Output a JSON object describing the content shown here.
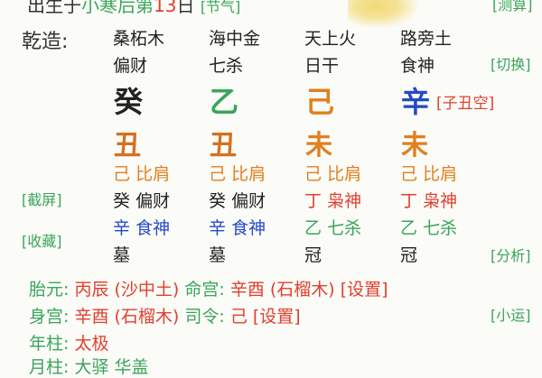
{
  "header": {
    "partial_left": "出生于",
    "partial_middle": "小寒后第",
    "partial_day": "13",
    "partial_unit": "日",
    "partial_tag": "[节气]",
    "partial_right": "[测算]"
  },
  "chart_label": "乾造:",
  "columns": [
    {
      "nayin": "桑柘木",
      "shishen": "偏财",
      "gan": "癸",
      "zhi": "丑",
      "hidden": [
        {
          "gan": "己",
          "shen": "比肩"
        },
        {
          "gan": "癸",
          "shen": "偏财"
        },
        {
          "gan": "辛",
          "shen": "食神"
        }
      ],
      "state": "墓"
    },
    {
      "nayin": "海中金",
      "shishen": "七杀",
      "gan": "乙",
      "zhi": "丑",
      "hidden": [
        {
          "gan": "己",
          "shen": "比肩"
        },
        {
          "gan": "癸",
          "shen": "偏财"
        },
        {
          "gan": "辛",
          "shen": "食神"
        }
      ],
      "state": "墓"
    },
    {
      "nayin": "天上火",
      "shishen": "日干",
      "gan": "己",
      "zhi": "未",
      "hidden": [
        {
          "gan": "己",
          "shen": "比肩"
        },
        {
          "gan": "丁",
          "shen": "枭神"
        },
        {
          "gan": "乙",
          "shen": "七杀"
        }
      ],
      "state": "冠"
    },
    {
      "nayin": "路旁土",
      "shishen": "食神",
      "gan": "辛",
      "zhi": "未",
      "hidden": [
        {
          "gan": "己",
          "shen": "比肩"
        },
        {
          "gan": "丁",
          "shen": "枭神"
        },
        {
          "gan": "乙",
          "shen": "七杀"
        }
      ],
      "state": "冠"
    }
  ],
  "kongwang": "[子丑空]",
  "side_buttons": {
    "switch": "[切换]",
    "screenshot": "[截屏]",
    "favorite": "[收藏]",
    "analyze": "[分析]",
    "xiaoyun": "[小运]"
  },
  "info": {
    "taiyuan_label": "胎元:",
    "taiyuan_value": "丙辰 (沙中土)",
    "minggong_label": "命宫:",
    "minggong_value": "辛酉 (石榴木)",
    "set1": "[设置]",
    "shengong_label": "身宫:",
    "shengong_value": "辛酉 (石榴木)",
    "siling_label": "司令:",
    "siling_value": "己",
    "set2": "[设置]",
    "nianzhu_label": "年柱:",
    "nianzhu_value": "太极",
    "partial_bottom": "月柱: 大驿 华盖"
  },
  "colors": {
    "green": "#3aa55a",
    "red": "#e0402d",
    "orange": "#e0801e",
    "blue": "#2449c8",
    "dark": "#222222"
  }
}
